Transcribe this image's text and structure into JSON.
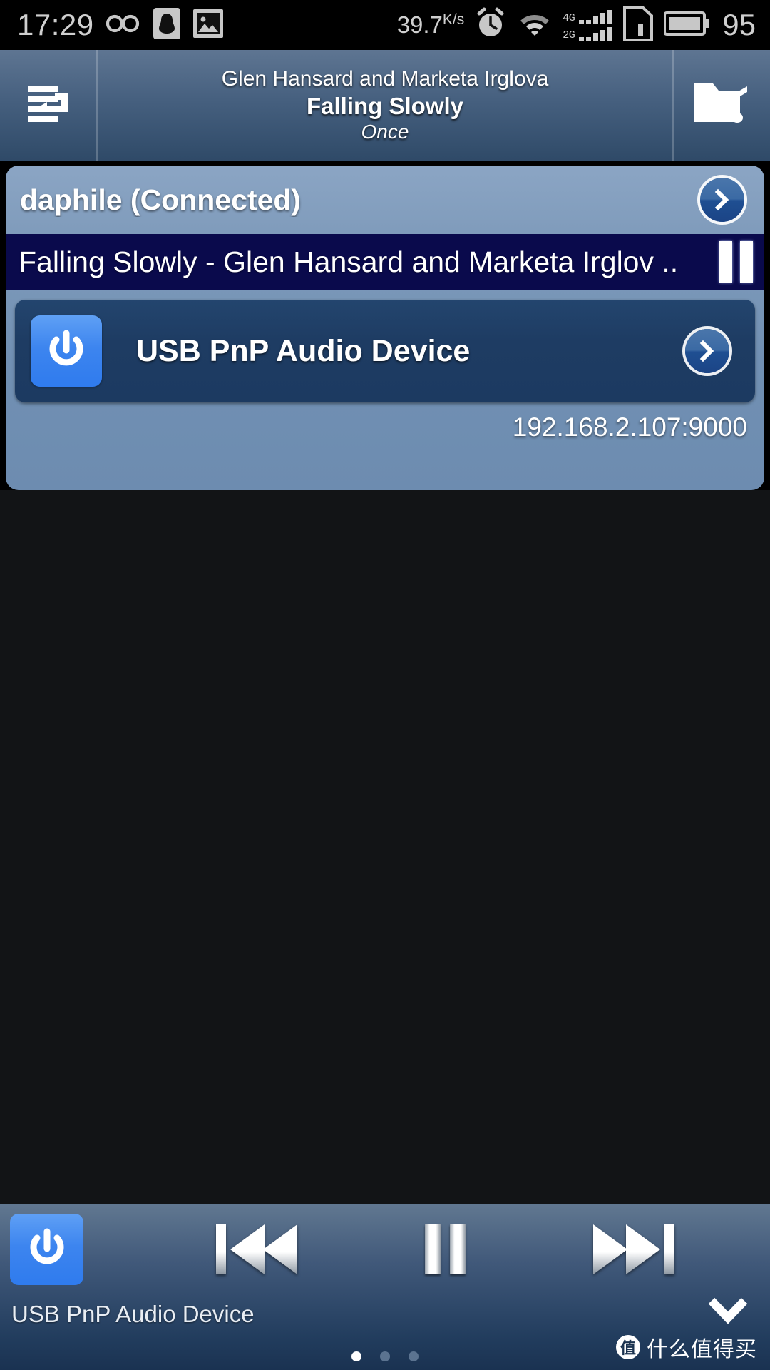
{
  "statusbar": {
    "clock": "17:29",
    "network_speed": "39.7",
    "network_speed_unit": "K/s",
    "battery_percent": "95",
    "icons": [
      "infinity-icon",
      "qq-penguin-icon",
      "image-icon",
      "alarm-clock-icon",
      "wifi-icon",
      "signal-4g-icon",
      "signal-2g-icon",
      "sim-card-icon",
      "battery-icon"
    ],
    "signal": {
      "row1_label": "4G",
      "row2_label": "2G"
    }
  },
  "titlebar": {
    "left_icon": "playlist-queue-icon",
    "right_icon": "folder-music-icon",
    "artist": "Glen Hansard and Marketa Irglova",
    "track": "Falling Slowly",
    "album": "Once"
  },
  "panel": {
    "server_name": "daphile (Connected)",
    "now_playing": "Falling Slowly - Glen Hansard and Marketa Irglov ..",
    "now_playing_state_icon": "pause-icon",
    "device": {
      "name": "USB PnP Audio Device",
      "power_icon": "power-icon",
      "detail_icon": "chevron-right-circle-icon"
    },
    "server_address": "192.168.2.107:9000"
  },
  "bottombar": {
    "power_icon": "power-icon",
    "previous_label": "previous-track",
    "pause_label": "pause",
    "next_label": "next-track",
    "device_name": "USB PnP Audio Device",
    "expand_icon": "chevron-down-icon",
    "page_dots": [
      true,
      false,
      false
    ],
    "watermark_badge": "值",
    "watermark_text": "什么值得买"
  },
  "colors": {
    "status_bg": "#000000",
    "titlebar_top": "#5e7592",
    "titlebar_bottom": "#2f4a68",
    "panel_bg": "#7f9bbb",
    "nowplaying_bg": "#0a0a4c",
    "card_bg": "#1e3c63",
    "accent_blue": "#3d85ef",
    "main_bg": "#121416"
  }
}
